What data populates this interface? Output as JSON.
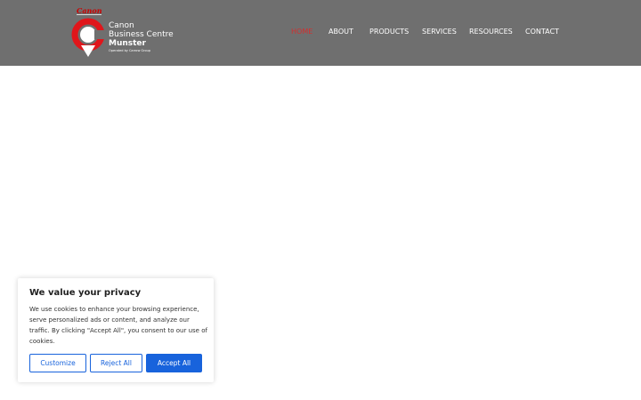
{
  "header": {
    "logo": {
      "brand": "Canon",
      "line1": "Canon",
      "line2": "Business Centre",
      "line3": "Munster",
      "line4": "Operated by Carrow Group",
      "icon": "canon-location-pin-icon"
    },
    "nav": [
      {
        "label": "HOME",
        "active": true
      },
      {
        "label": "ABOUT",
        "active": false
      },
      {
        "label": "PRODUCTS",
        "active": false
      },
      {
        "label": "SERVICES",
        "active": false
      },
      {
        "label": "RESOURCES",
        "active": false
      },
      {
        "label": "CONTACT",
        "active": false
      }
    ]
  },
  "cookie_banner": {
    "title": "We value your privacy",
    "text": "We use cookies to enhance your browsing experience, serve personalized ads or content, and analyze our traffic. By clicking \"Accept All\", you consent to our use of cookies.",
    "customize_label": "Customize",
    "reject_label": "Reject All",
    "accept_label": "Accept All"
  },
  "colors": {
    "header_bg": "#6f6f6f",
    "active_nav": "#d32f2f",
    "accent_blue": "#1863dc",
    "logo_red": "#cc0000"
  }
}
